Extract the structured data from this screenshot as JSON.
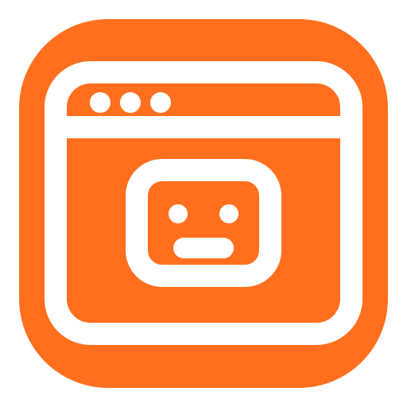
{
  "app_icon": {
    "icon_name": "browser-window-robot-icon",
    "colors": {
      "background": "#ffffff",
      "tile": "#FF6F1E",
      "foreground": "#ffffff"
    },
    "title_bar": {
      "dots_count": 3,
      "dot_icon_names": [
        "window-dot-icon",
        "window-dot-icon",
        "window-dot-icon"
      ]
    },
    "face": {
      "icon_name": "robot-face-icon",
      "eyes_count": 2,
      "mouth": "straight"
    }
  }
}
